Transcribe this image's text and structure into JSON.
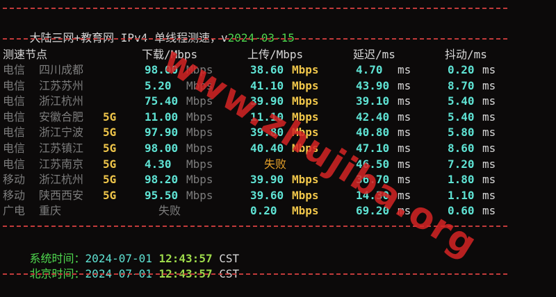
{
  "title": {
    "text": "大陆三网+教育网 IPv4 单线程测速，v",
    "version": "2024-03-15"
  },
  "headers": {
    "node": "测速节点",
    "download": "下载/Mbps",
    "upload": "上传/Mbps",
    "latency": "延迟/ms",
    "jitter": "抖动/ms"
  },
  "rows": [
    {
      "isp": "电信",
      "city": "四川成都",
      "tag": "",
      "down": "98.00",
      "down_unit": "Mbps",
      "up": "38.60",
      "up_unit": "Mbps",
      "lat": "4.70",
      "lat_unit": "ms",
      "jit": "0.20",
      "jit_unit": "ms"
    },
    {
      "isp": "电信",
      "city": "江苏苏州",
      "tag": "",
      "down": "5.20",
      "down_unit": "Mbps",
      "up": "41.10",
      "up_unit": "Mbps",
      "lat": "43.90",
      "lat_unit": "ms",
      "jit": "8.70",
      "jit_unit": "ms"
    },
    {
      "isp": "电信",
      "city": "浙江杭州",
      "tag": "",
      "down": "75.40",
      "down_unit": "Mbps",
      "up": "39.90",
      "up_unit": "Mbps",
      "lat": "39.10",
      "lat_unit": "ms",
      "jit": "5.40",
      "jit_unit": "ms"
    },
    {
      "isp": "电信",
      "city": "安徽合肥",
      "tag": "5G",
      "down": "11.00",
      "down_unit": "Mbps",
      "up": "11.10",
      "up_unit": "Mbps",
      "lat": "42.40",
      "lat_unit": "ms",
      "jit": "5.40",
      "jit_unit": "ms"
    },
    {
      "isp": "电信",
      "city": "浙江宁波",
      "tag": "5G",
      "down": "97.90",
      "down_unit": "Mbps",
      "up": "39.80",
      "up_unit": "Mbps",
      "lat": "40.80",
      "lat_unit": "ms",
      "jit": "5.80",
      "jit_unit": "ms"
    },
    {
      "isp": "电信",
      "city": "江苏镇江",
      "tag": "5G",
      "down": "98.00",
      "down_unit": "Mbps",
      "up": "40.40",
      "up_unit": "Mbps",
      "lat": "47.10",
      "lat_unit": "ms",
      "jit": "8.60",
      "jit_unit": "ms"
    },
    {
      "isp": "电信",
      "city": "江苏南京",
      "tag": "5G",
      "down": "4.30",
      "down_unit": "Mbps",
      "up": "失败",
      "up_unit": "",
      "lat": "46.50",
      "lat_unit": "ms",
      "jit": "7.20",
      "jit_unit": "ms"
    },
    {
      "isp": "移动",
      "city": "浙江杭州",
      "tag": "5G",
      "down": "98.20",
      "down_unit": "Mbps",
      "up": "39.90",
      "up_unit": "Mbps",
      "lat": "36.70",
      "lat_unit": "ms",
      "jit": "1.80",
      "jit_unit": "ms"
    },
    {
      "isp": "移动",
      "city": "陕西西安",
      "tag": "5G",
      "down": "95.50",
      "down_unit": "Mbps",
      "up": "39.60",
      "up_unit": "Mbps",
      "lat": "14.30",
      "lat_unit": "ms",
      "jit": "1.10",
      "jit_unit": "ms"
    },
    {
      "isp": "广电",
      "city": "重庆",
      "tag": "",
      "down": "失败",
      "down_unit": "",
      "up": "0.20",
      "up_unit": "Mbps",
      "lat": "69.20",
      "lat_unit": "ms",
      "jit": "0.60",
      "jit_unit": "ms"
    }
  ],
  "footer": {
    "system_label": "系统时间：",
    "system_date": "2024-07-01",
    "system_time": "12:43:57",
    "system_tz": "CST",
    "beijing_label": "北京时间：",
    "beijing_date": "2024-07-01",
    "beijing_time": "12:43:57",
    "beijing_tz": "CST"
  },
  "watermark": "www.zhujiba.org"
}
